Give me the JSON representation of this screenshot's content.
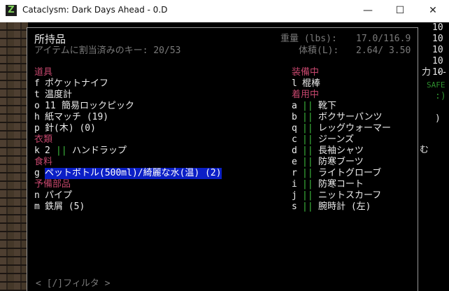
{
  "window": {
    "title": "Cataclysm: Dark Days Ahead - 0.D",
    "icon_letter": "Z",
    "minimize": "—",
    "maximize": "☐",
    "close": "✕"
  },
  "inventory": {
    "title": "所持品",
    "hotkeys_assigned": "アイテムに割当済みのキー: 20/53",
    "weight_label": "重量 (lbs):",
    "weight_value": "17.0/116.9",
    "volume_label": "体積(L):",
    "volume_value": "2.64/ 3.50",
    "filter_hint": "< [/]フィルタ >",
    "left_column": [
      {
        "type": "category",
        "text": "道具"
      },
      {
        "type": "item",
        "key": "f",
        "name": "ポケットナイフ"
      },
      {
        "type": "item",
        "key": "t",
        "name": "温度計"
      },
      {
        "type": "item",
        "key": "o",
        "count": "11",
        "name": "簡易ロックピック"
      },
      {
        "type": "item",
        "key": "h",
        "name": "紙マッチ (19)"
      },
      {
        "type": "item",
        "key": "p",
        "name": "針(木) (0)"
      },
      {
        "type": "category",
        "text": "衣類"
      },
      {
        "type": "item",
        "key": "k",
        "count": "2",
        "mark": "||",
        "name": "ハンドラップ"
      },
      {
        "type": "category",
        "text": "食料"
      },
      {
        "type": "item",
        "key": "g",
        "name": "ペットボトル(500ml)/綺麗な水(温) (2)",
        "selected": true
      },
      {
        "type": "category",
        "text": "予備部品"
      },
      {
        "type": "item",
        "key": "n",
        "name": "パイプ"
      },
      {
        "type": "item",
        "key": "m",
        "name": "鉄屑 (5)"
      }
    ],
    "right_column": [
      {
        "type": "category",
        "text": "装備中"
      },
      {
        "type": "item",
        "key": "l",
        "name": "棍棒"
      },
      {
        "type": "category",
        "text": "着用中"
      },
      {
        "type": "item",
        "key": "a",
        "mark": "||",
        "name": "靴下"
      },
      {
        "type": "item",
        "key": "b",
        "mark": "||",
        "name": "ボクサーパンツ"
      },
      {
        "type": "item",
        "key": "q",
        "mark": "||",
        "name": "レッグウォーマー"
      },
      {
        "type": "item",
        "key": "c",
        "mark": "||",
        "name": "ジーンズ"
      },
      {
        "type": "item",
        "key": "d",
        "mark": "||",
        "name": "長袖シャツ"
      },
      {
        "type": "item",
        "key": "e",
        "mark": "||",
        "name": "防寒ブーツ"
      },
      {
        "type": "item",
        "key": "r",
        "mark": "||",
        "name": "ライトグローブ"
      },
      {
        "type": "item",
        "key": "i",
        "mark": "||",
        "name": "防寒コート"
      },
      {
        "type": "item",
        "key": "j",
        "mark": "||",
        "name": "ニットスカーフ"
      },
      {
        "type": "item",
        "key": "s",
        "mark": "||",
        "name": "腕時計 (左)"
      }
    ]
  },
  "sidebar": {
    "lines": [
      "10",
      "10",
      "10",
      "10",
      "10",
      "力 --",
      "SAFE",
      ":)",
      ")",
      "む"
    ]
  },
  "colors": {
    "category": "#c4466c",
    "selection": "#0b1fc6",
    "mark": "#3fbf3f",
    "text": "#bdbdbd"
  }
}
